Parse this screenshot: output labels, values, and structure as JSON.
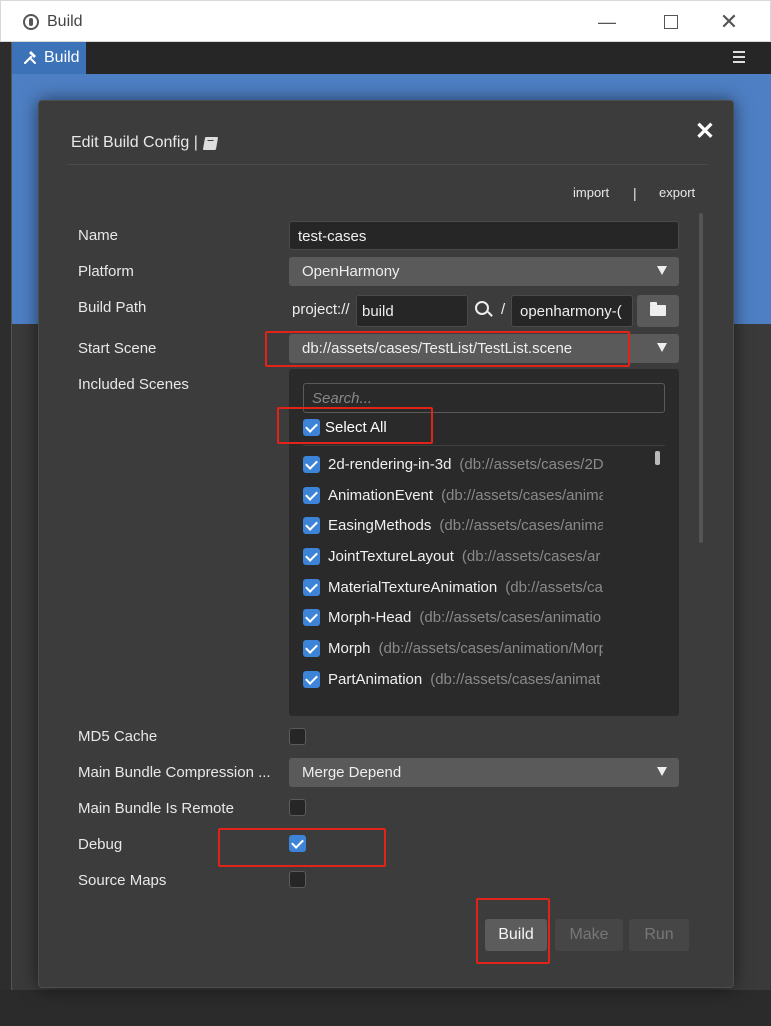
{
  "window": {
    "title": "Build",
    "minimize_glyph": "—",
    "close_glyph": "✕",
    "tab_label": "Build",
    "tab_icon": "hammer-icon"
  },
  "dialog": {
    "title": "Edit Build Config |",
    "close_glyph": "✕",
    "links": {
      "import": "import",
      "separator": "|",
      "export": "export"
    },
    "fields": {
      "name_label": "Name",
      "name_value": "test-cases",
      "platform_label": "Platform",
      "platform_value": "OpenHarmony",
      "build_path_label": "Build Path",
      "build_path_prefix": "project://",
      "build_path_dir": "build",
      "build_path_slash": "/",
      "build_path_sub": "openharmony-(",
      "start_scene_label": "Start Scene",
      "start_scene_value": "db://assets/cases/TestList/TestList.scene",
      "included_scenes_label": "Included Scenes",
      "scene_search_placeholder": "Search...",
      "select_all_label": "Select All",
      "scenes": [
        {
          "name": "2d-rendering-in-3d",
          "path": "(db://assets/cases/2D"
        },
        {
          "name": "AnimationEvent",
          "path": "(db://assets/cases/anima"
        },
        {
          "name": "EasingMethods",
          "path": "(db://assets/cases/anima"
        },
        {
          "name": "JointTextureLayout",
          "path": "(db://assets/cases/ar"
        },
        {
          "name": "MaterialTextureAnimation",
          "path": "(db://assets/ca"
        },
        {
          "name": "Morph-Head",
          "path": "(db://assets/cases/animatio"
        },
        {
          "name": "Morph",
          "path": "(db://assets/cases/animation/Morp"
        },
        {
          "name": "PartAnimation",
          "path": "(db://assets/cases/animat"
        }
      ],
      "md5_label": "MD5 Cache",
      "md5_checked": false,
      "compression_label": "Main Bundle Compression ...",
      "compression_value": "Merge Depend",
      "remote_label": "Main Bundle Is Remote",
      "remote_checked": false,
      "debug_label": "Debug",
      "debug_checked": true,
      "sourcemaps_label": "Source Maps",
      "sourcemaps_checked": false
    },
    "buttons": {
      "build": "Build",
      "make": "Make",
      "run": "Run"
    }
  },
  "colors": {
    "accent": "#3d84d8",
    "tab_active": "#3c73b8",
    "highlight": "#e2231a",
    "dialog_bg": "#3c3c3c"
  }
}
